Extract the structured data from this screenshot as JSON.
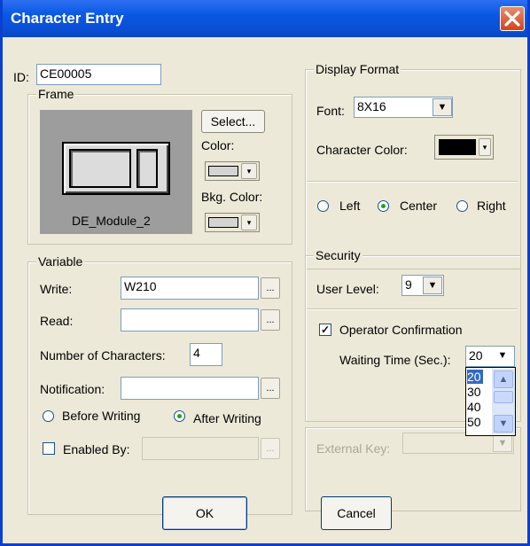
{
  "window": {
    "title": "Character Entry"
  },
  "id_field": {
    "label": "ID:",
    "value": "CE00005"
  },
  "frame": {
    "legend": "Frame",
    "preview_label": "DE_Module_2",
    "select_button": "Select...",
    "color_label": "Color:",
    "bkg_color_label": "Bkg. Color:",
    "color_value": "#d4d4d4",
    "bkg_color_value": "#d4d4d4"
  },
  "display_format": {
    "legend": "Display Format",
    "font_label": "Font:",
    "font_value": "8X16",
    "char_color_label": "Character Color:",
    "char_color_value": "#000000",
    "alignment": {
      "left": "Left",
      "center": "Center",
      "right": "Right",
      "selected": "Center"
    }
  },
  "variable": {
    "legend": "Variable",
    "write_label": "Write:",
    "write_value": "W210",
    "read_label": "Read:",
    "read_value": "",
    "ellipsis": "...",
    "num_chars_label": "Number of Characters:",
    "num_chars_value": "4",
    "notification_label": "Notification:",
    "notification_value": "",
    "before_writing": "Before Writing",
    "after_writing": "After Writing",
    "write_timing_selected": "After Writing",
    "enabled_by_label": "Enabled By:",
    "enabled_by_checked": false
  },
  "security": {
    "legend": "Security",
    "user_level_label": "User Level:",
    "user_level_value": "9",
    "operator_confirmation": "Operator Confirmation",
    "operator_confirmation_checked": true,
    "waiting_time_label": "Waiting Time (Sec.):",
    "waiting_time_value": "20",
    "waiting_time_options": [
      "20",
      "30",
      "40",
      "50"
    ]
  },
  "external_key": {
    "label": "External Key:"
  },
  "buttons": {
    "ok": "OK",
    "cancel": "Cancel"
  }
}
